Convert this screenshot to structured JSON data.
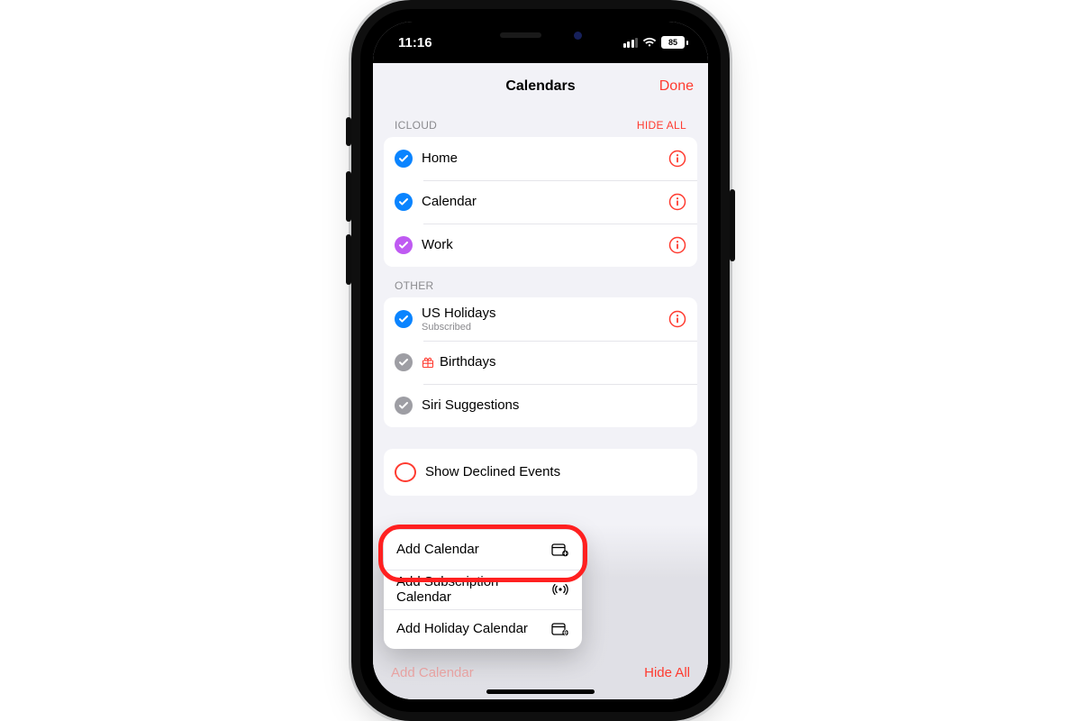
{
  "status": {
    "time": "11:16",
    "battery": "85"
  },
  "sheet": {
    "title": "Calendars",
    "done": "Done",
    "sections": {
      "icloud": {
        "header": "ICLOUD",
        "action": "HIDE ALL",
        "items": [
          {
            "label": "Home"
          },
          {
            "label": "Calendar"
          },
          {
            "label": "Work"
          }
        ]
      },
      "other": {
        "header": "OTHER",
        "items": [
          {
            "label": "US Holidays",
            "sub": "Subscribed"
          },
          {
            "label": "Birthdays"
          },
          {
            "label": "Siri Suggestions"
          }
        ]
      },
      "declined": {
        "label": "Show Declined Events"
      }
    }
  },
  "popover": {
    "items": [
      {
        "label": "Add Calendar"
      },
      {
        "label": "Add Subscription Calendar"
      },
      {
        "label": "Add Holiday Calendar"
      }
    ]
  },
  "toolbar": {
    "add": "Add Calendar",
    "hide": "Hide All"
  }
}
